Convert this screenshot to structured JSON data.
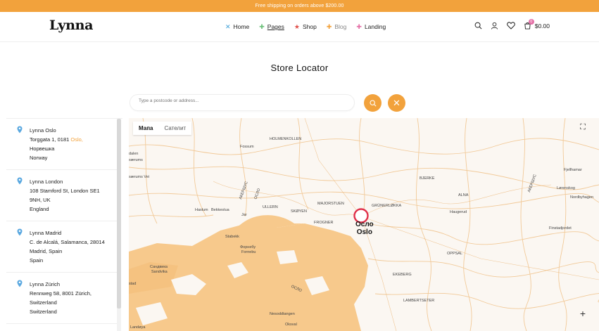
{
  "topbar": {
    "text": "Free shipping on orders above $200.00"
  },
  "header": {
    "logo": "Lynna",
    "nav": [
      {
        "label": "Home",
        "icon": "x-mark-icon",
        "color": "#3b9fd6"
      },
      {
        "label": "Pages",
        "icon": "plus-icon",
        "color": "#6cc07a"
      },
      {
        "label": "Shop",
        "icon": "star-icon",
        "color": "#e0504a"
      },
      {
        "label": "Blog",
        "icon": "plus-icon",
        "color": "#f2a23c"
      },
      {
        "label": "Landing",
        "icon": "plus-icon",
        "color": "#e46fa6"
      }
    ],
    "cart": {
      "count": "0",
      "total": "$0.00"
    }
  },
  "page": {
    "title": "Store Locator",
    "search_placeholder": "Type a postcode or address..."
  },
  "accent": "#f2a23c",
  "stores": [
    {
      "name": "Lynna Oslo",
      "line1a": "Torggata 1, 0181 ",
      "line1b": "Oslo,",
      "line2": "Норвешка",
      "line3": "Norway"
    },
    {
      "name": "Lynna London",
      "line1a": "108 Stamford St, London SE1",
      "line1b": "",
      "line2": "9NH, UK",
      "line3": "England"
    },
    {
      "name": "Lynna Madrid",
      "line1a": "C. de Alcalá, Salamanca, 28014",
      "line1b": "",
      "line2": "Madrid, Spain",
      "line3": "Spain"
    },
    {
      "name": "Lynna Zürich",
      "line1a": "Rennweg 58, 8001 Zürich,",
      "line1b": "",
      "line2": "Switzerland",
      "line3": "Switzerland"
    }
  ],
  "map": {
    "tabs": [
      "Мапа",
      "Сателит"
    ],
    "city_cyrillic": "Осло",
    "city": "Oslo",
    "labels": {
      "fossum": "Fossum",
      "holmenkollen": "HOLMENKOLLEN",
      "dalen": "dalen",
      "serums": "særums",
      "serums_vei": "særums Vei",
      "haslum": "Haslum",
      "bekkestua": "Bekkestua",
      "jar": "Jar",
      "ullern": "ULLERN",
      "skoyen": "SKØYEN",
      "majorstuen": "MAJORSTUEN",
      "grunerlokka": "GRÜNERLØKKA",
      "bjerke": "BJERKE",
      "alna": "ALNA",
      "haugerud": "Haugerud",
      "frogner": "FROGNER",
      "stabekk": "Stabekk",
      "fornebu_c": "Форнебу",
      "fornebu": "Fornebu",
      "sandvika_c": "Сандвика",
      "sandvika": "Sandvika",
      "opsal": "OPPSAL",
      "ekeberg": "EKEBERG",
      "lambertseter": "LAMBERTSETER",
      "nesodd": "Nesoddtangen",
      "oksval": "Oksval",
      "landeya": "Landøya",
      "stad": "stad",
      "fjellhamar": "Fjellhamar",
      "lorenskog": "Lørenskog",
      "finstadjordet": "Finstadjordet",
      "nordbyhagen": "Nordbyhagen",
      "akershus": "АКЕРШУС",
      "oslo_area": "ОСЛО"
    }
  }
}
